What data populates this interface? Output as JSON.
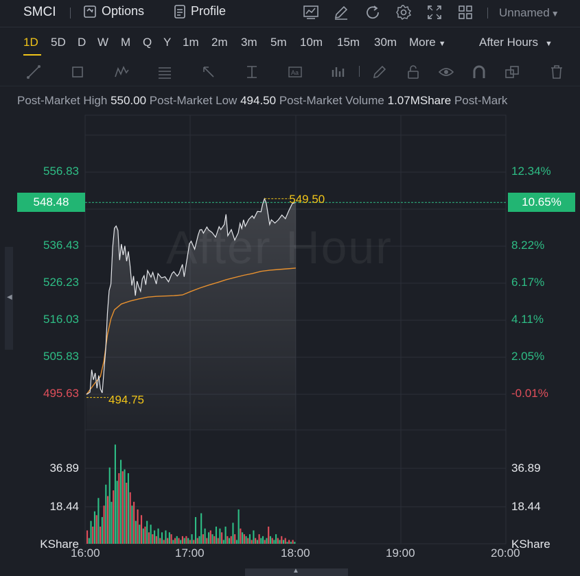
{
  "header": {
    "symbol": "SMCI",
    "options_label": "Options",
    "profile_label": "Profile",
    "layout_name": "Unnamed",
    "icons": [
      "chart-icon",
      "draw-icon",
      "refresh-icon",
      "settings-icon",
      "fullscreen-icon",
      "grid-layout-icon"
    ]
  },
  "timeframes": {
    "items": [
      "1D",
      "5D",
      "D",
      "W",
      "M",
      "Q",
      "Y",
      "1m",
      "2m",
      "3m",
      "5m",
      "10m",
      "15m",
      "30m",
      "More"
    ],
    "active": "1D",
    "session": "After Hours"
  },
  "drawing_tools": [
    "line-tool-icon",
    "rectangle-tool-icon",
    "pattern-tool-icon",
    "fib-tool-icon",
    "arrow-tool-icon",
    "measure-tool-icon",
    "text-tool-icon",
    "indicator-tool-icon",
    "pencil-tool-icon",
    "lock-tool-icon",
    "eye-tool-icon",
    "magnet-tool-icon",
    "clone-tool-icon",
    "trash-tool-icon"
  ],
  "stats": {
    "high_label": "Post-Market High",
    "high_value": "550.00",
    "low_label": "Post-Market Low",
    "low_value": "494.50",
    "volume_label": "Post-Market Volume",
    "volume_value": "1.07MShare",
    "extra_label": "Post-Mark"
  },
  "price_axis": {
    "labels": [
      "556.83",
      "536.43",
      "526.23",
      "516.03",
      "505.83",
      "495.63"
    ],
    "current_price": "548.48"
  },
  "percent_axis": {
    "labels": [
      "12.34%",
      "8.22%",
      "6.17%",
      "4.11%",
      "2.05%",
      "-0.01%"
    ],
    "current_percent": "10.65%"
  },
  "volume_axis": {
    "labels": [
      "36.89",
      "18.44"
    ],
    "unit": "KShare"
  },
  "time_axis": [
    "16:00",
    "17:00",
    "18:00",
    "19:00",
    "20:00"
  ],
  "watermark": "After Hour",
  "annotations": {
    "high": "549.50",
    "low": "494.75"
  },
  "colors": {
    "up": "#2ebd85",
    "down": "#e04f5b",
    "accent": "#f0c419",
    "avg_line": "#e8912f",
    "price_tag": "#22b573"
  },
  "chart_data": {
    "type": "line",
    "title": "",
    "xlabel": "",
    "ylabel": "",
    "x_range": [
      "16:00",
      "20:00"
    ],
    "ylim": [
      495.63,
      556.83
    ],
    "series": [
      {
        "values": [
          [
            "16:00",
            495.6
          ],
          [
            "16:02",
            496.2
          ],
          [
            "16:03",
            502.4
          ],
          [
            "16:04",
            499.6
          ],
          [
            "16:05",
            501.5
          ],
          [
            "16:06",
            497.3
          ],
          [
            "16:07",
            500.8
          ],
          [
            "16:08",
            497.1
          ],
          [
            "16:09",
            496.0
          ],
          [
            "16:10",
            502.0
          ],
          [
            "16:11",
            508.0
          ],
          [
            "16:12",
            518.0
          ],
          [
            "16:13",
            524.2
          ],
          [
            "16:14",
            526.0
          ],
          [
            "16:15",
            536.0
          ],
          [
            "16:16",
            541.4
          ],
          [
            "16:17",
            542.0
          ],
          [
            "16:18",
            540.8
          ],
          [
            "16:19",
            532.6
          ],
          [
            "16:20",
            537.0
          ],
          [
            "16:21",
            534.0
          ],
          [
            "16:22",
            536.5
          ],
          [
            "16:23",
            532.3
          ],
          [
            "16:24",
            535.0
          ],
          [
            "16:25",
            531.0
          ],
          [
            "16:26",
            525.6
          ],
          [
            "16:27",
            528.2
          ],
          [
            "16:28",
            522.8
          ],
          [
            "16:29",
            526.8
          ],
          [
            "16:30",
            525.2
          ],
          [
            "16:31",
            524.0
          ],
          [
            "16:32",
            527.4
          ],
          [
            "16:33",
            528.3
          ],
          [
            "16:34",
            525.8
          ],
          [
            "16:35",
            529.7
          ],
          [
            "16:37",
            527.9
          ],
          [
            "16:38",
            529.2
          ],
          [
            "16:40",
            526.0
          ],
          [
            "16:41",
            528.9
          ],
          [
            "16:43",
            527.7
          ],
          [
            "16:45",
            528.0
          ],
          [
            "16:47",
            526.6
          ],
          [
            "16:49",
            528.9
          ],
          [
            "16:50",
            529.4
          ],
          [
            "16:52",
            528.2
          ],
          [
            "16:53",
            528.8
          ],
          [
            "16:55",
            531.4
          ],
          [
            "16:56",
            528.0
          ],
          [
            "16:58",
            534.0
          ],
          [
            "16:59",
            537.1
          ],
          [
            "17:00",
            537.8
          ],
          [
            "17:02",
            535.6
          ],
          [
            "17:04",
            539.5
          ],
          [
            "17:05",
            540.9
          ],
          [
            "17:06",
            541.0
          ],
          [
            "17:07",
            540.0
          ],
          [
            "17:09",
            541.7
          ],
          [
            "17:10",
            540.9
          ],
          [
            "17:12",
            540.2
          ],
          [
            "17:14",
            538.9
          ],
          [
            "17:16",
            541.8
          ],
          [
            "17:17",
            541.0
          ],
          [
            "17:19",
            542.4
          ],
          [
            "17:20",
            545.2
          ],
          [
            "17:21",
            539.3
          ],
          [
            "17:23",
            541.0
          ],
          [
            "17:25",
            538.1
          ],
          [
            "17:27",
            540.1
          ],
          [
            "17:28",
            542.7
          ],
          [
            "17:29",
            541.3
          ],
          [
            "17:30",
            543.7
          ],
          [
            "17:31",
            541.9
          ],
          [
            "17:33",
            543.8
          ],
          [
            "17:35",
            544.8
          ],
          [
            "17:36",
            544.1
          ],
          [
            "17:38",
            546.0
          ],
          [
            "17:40",
            545.9
          ],
          [
            "17:41",
            548.0
          ],
          [
            "17:42",
            549.5
          ],
          [
            "17:43",
            548.4
          ],
          [
            "17:45",
            542.4
          ],
          [
            "17:46",
            543.7
          ],
          [
            "17:48",
            542.8
          ],
          [
            "17:50",
            543.7
          ],
          [
            "17:52",
            545.0
          ],
          [
            "17:54",
            544.0
          ],
          [
            "17:56",
            546.2
          ],
          [
            "17:58",
            548.2
          ],
          [
            "18:00",
            548.48
          ]
        ]
      },
      {
        "values": [
          [
            "16:00",
            495.6
          ],
          [
            "16:03",
            497.5
          ],
          [
            "16:05",
            498.8
          ],
          [
            "16:08",
            500.5
          ],
          [
            "16:10",
            504.8
          ],
          [
            "16:12",
            512.0
          ],
          [
            "16:14",
            516.4
          ],
          [
            "16:16",
            518.9
          ],
          [
            "16:20",
            520.5
          ],
          [
            "16:25",
            521.3
          ],
          [
            "16:30",
            521.9
          ],
          [
            "16:35",
            522.4
          ],
          [
            "16:40",
            522.6
          ],
          [
            "16:45",
            522.7
          ],
          [
            "16:50",
            522.8
          ],
          [
            "16:55",
            523.0
          ],
          [
            "17:00",
            524.0
          ],
          [
            "17:05",
            524.9
          ],
          [
            "17:10",
            525.7
          ],
          [
            "17:15",
            526.4
          ],
          [
            "17:20",
            527.2
          ],
          [
            "17:25",
            527.8
          ],
          [
            "17:30",
            528.4
          ],
          [
            "17:35",
            528.9
          ],
          [
            "17:40",
            529.5
          ],
          [
            "17:45",
            529.8
          ],
          [
            "17:50",
            530.0
          ],
          [
            "17:55",
            530.2
          ],
          [
            "18:00",
            530.4
          ]
        ]
      }
    ],
    "volume": {
      "unit": "KShare",
      "ylim": [
        0,
        55
      ],
      "bars": [
        [
          7,
          "down"
        ],
        [
          3,
          "up"
        ],
        [
          12,
          "up"
        ],
        [
          9,
          "down"
        ],
        [
          17,
          "up"
        ],
        [
          15,
          "down"
        ],
        [
          24,
          "up"
        ],
        [
          9,
          "down"
        ],
        [
          14,
          "up"
        ],
        [
          20,
          "down"
        ],
        [
          31,
          "up"
        ],
        [
          25,
          "down"
        ],
        [
          40,
          "up"
        ],
        [
          22,
          "up"
        ],
        [
          28,
          "down"
        ],
        [
          52,
          "up"
        ],
        [
          33,
          "up"
        ],
        [
          37,
          "down"
        ],
        [
          44,
          "up"
        ],
        [
          38,
          "down"
        ],
        [
          39,
          "up"
        ],
        [
          32,
          "down"
        ],
        [
          37,
          "up"
        ],
        [
          27,
          "down"
        ],
        [
          20,
          "up"
        ],
        [
          22,
          "down"
        ],
        [
          12,
          "up"
        ],
        [
          18,
          "down"
        ],
        [
          10,
          "up"
        ],
        [
          15,
          "down"
        ],
        [
          8,
          "up"
        ],
        [
          9,
          "down"
        ],
        [
          12,
          "up"
        ],
        [
          6,
          "down"
        ],
        [
          10,
          "up"
        ],
        [
          5,
          "down"
        ],
        [
          7,
          "up"
        ],
        [
          4,
          "down"
        ],
        [
          8,
          "up"
        ],
        [
          3,
          "down"
        ],
        [
          6,
          "up"
        ],
        [
          2,
          "down"
        ],
        [
          7,
          "up"
        ],
        [
          3,
          "down"
        ],
        [
          6,
          "up"
        ],
        [
          5,
          "down"
        ],
        [
          2,
          "up"
        ],
        [
          3,
          "down"
        ],
        [
          4,
          "up"
        ],
        [
          3,
          "down"
        ],
        [
          2,
          "up"
        ],
        [
          4,
          "down"
        ],
        [
          3,
          "up"
        ],
        [
          4,
          "down"
        ],
        [
          3,
          "up"
        ],
        [
          2,
          "down"
        ],
        [
          5,
          "up"
        ],
        [
          2,
          "down"
        ],
        [
          14,
          "up"
        ],
        [
          3,
          "down"
        ],
        [
          4,
          "up"
        ],
        [
          16,
          "up"
        ],
        [
          5,
          "down"
        ],
        [
          8,
          "up"
        ],
        [
          3,
          "down"
        ],
        [
          6,
          "up"
        ],
        [
          7,
          "down"
        ],
        [
          5,
          "up"
        ],
        [
          4,
          "down"
        ],
        [
          9,
          "up"
        ],
        [
          3,
          "down"
        ],
        [
          8,
          "up"
        ],
        [
          6,
          "down"
        ],
        [
          2,
          "up"
        ],
        [
          9,
          "up"
        ],
        [
          4,
          "down"
        ],
        [
          3,
          "up"
        ],
        [
          4,
          "down"
        ],
        [
          11,
          "up"
        ],
        [
          5,
          "down"
        ],
        [
          2,
          "up"
        ],
        [
          18,
          "up"
        ],
        [
          8,
          "down"
        ],
        [
          6,
          "up"
        ],
        [
          5,
          "down"
        ],
        [
          4,
          "up"
        ],
        [
          3,
          "down"
        ],
        [
          5,
          "up"
        ],
        [
          2,
          "down"
        ],
        [
          7,
          "up"
        ],
        [
          3,
          "down"
        ],
        [
          2,
          "up"
        ],
        [
          5,
          "down"
        ],
        [
          3,
          "up"
        ],
        [
          4,
          "up"
        ],
        [
          2,
          "down"
        ],
        [
          3,
          "up"
        ],
        [
          9,
          "down"
        ],
        [
          4,
          "up"
        ],
        [
          3,
          "down"
        ],
        [
          2,
          "up"
        ],
        [
          5,
          "up"
        ],
        [
          3,
          "down"
        ],
        [
          2,
          "up"
        ],
        [
          4,
          "down"
        ],
        [
          2,
          "up"
        ],
        [
          3,
          "down"
        ],
        [
          1,
          "up"
        ],
        [
          2,
          "down"
        ],
        [
          1,
          "up"
        ],
        [
          2,
          "down"
        ],
        [
          1,
          "up"
        ]
      ]
    }
  }
}
